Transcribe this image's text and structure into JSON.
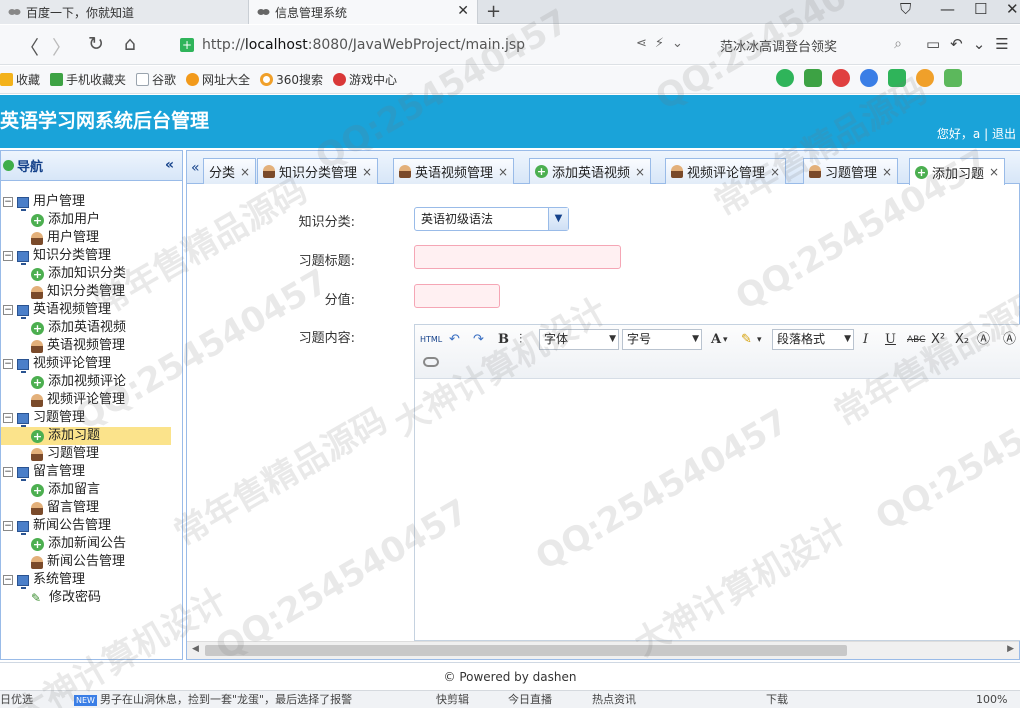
{
  "browser": {
    "tabs": [
      {
        "label": "百度一下，你就知道"
      },
      {
        "label": "信息管理系统"
      }
    ],
    "url_scheme": "http://",
    "url_host": "localhost",
    "url_rest": ":8080/JavaWebProject/main.jsp",
    "search_text": "范冰冰高调登台领奖",
    "bookmarks": [
      {
        "label": "收藏",
        "icon": "star-icon",
        "color": "#f3b21b"
      },
      {
        "label": "手机收藏夹",
        "icon": "phone-icon",
        "color": "#3da244"
      },
      {
        "label": "谷歌",
        "icon": "page-icon",
        "color": "#9aa4ae"
      },
      {
        "label": "网址大全",
        "icon": "globe-icon",
        "color": "#f29a1b"
      },
      {
        "label": "360搜索",
        "icon": "search-circle-icon",
        "color": "#f0a02a"
      },
      {
        "label": "游戏中心",
        "icon": "game-icon",
        "color": "#d93838"
      }
    ]
  },
  "app": {
    "title": "英语学习网系统后台管理",
    "greeting": "您好，a",
    "divider": "|",
    "logout": "退出"
  },
  "sidebar": {
    "title": "导航",
    "collapse": "«",
    "groups": [
      {
        "label": "用户管理",
        "children": [
          {
            "label": "添加用户",
            "icon": "add"
          },
          {
            "label": "用户管理",
            "icon": "user"
          }
        ]
      },
      {
        "label": "知识分类管理",
        "children": [
          {
            "label": "添加知识分类",
            "icon": "add"
          },
          {
            "label": "知识分类管理",
            "icon": "user"
          }
        ]
      },
      {
        "label": "英语视频管理",
        "children": [
          {
            "label": "添加英语视频",
            "icon": "add"
          },
          {
            "label": "英语视频管理",
            "icon": "user"
          }
        ]
      },
      {
        "label": "视频评论管理",
        "children": [
          {
            "label": "添加视频评论",
            "icon": "add"
          },
          {
            "label": "视频评论管理",
            "icon": "user"
          }
        ]
      },
      {
        "label": "习题管理",
        "children": [
          {
            "label": "添加习题",
            "icon": "add",
            "selected": true
          },
          {
            "label": "习题管理",
            "icon": "user"
          }
        ]
      },
      {
        "label": "留言管理",
        "children": [
          {
            "label": "添加留言",
            "icon": "add"
          },
          {
            "label": "留言管理",
            "icon": "user"
          }
        ]
      },
      {
        "label": "新闻公告管理",
        "children": [
          {
            "label": "添加新闻公告",
            "icon": "add"
          },
          {
            "label": "新闻公告管理",
            "icon": "user"
          }
        ]
      },
      {
        "label": "系统管理",
        "children": [
          {
            "label": "修改密码",
            "icon": "pen"
          }
        ]
      }
    ]
  },
  "tabs": [
    {
      "label": "分类",
      "icon": ""
    },
    {
      "label": "知识分类管理",
      "icon": "user"
    },
    {
      "label": "英语视频管理",
      "icon": "user"
    },
    {
      "label": "添加英语视频",
      "icon": "add"
    },
    {
      "label": "视频评论管理",
      "icon": "user"
    },
    {
      "label": "习题管理",
      "icon": "user"
    },
    {
      "label": "添加习题",
      "icon": "add",
      "active": true
    }
  ],
  "tab_close": "×",
  "tab_scroll": "«",
  "form": {
    "category_label": "知识分类:",
    "category_value": "英语初级语法",
    "title_label": "习题标题:",
    "title_value": "",
    "score_label": "分值:",
    "score_value": "",
    "content_label": "习题内容:",
    "toolbar": {
      "html": "HTML",
      "bold": "B",
      "font": "字体",
      "size": "字号",
      "fontcolor": "A",
      "paragraph": "段落格式",
      "italic": "I",
      "underline": "U",
      "strike": "ABC",
      "sup": "X²",
      "sub": "X₂"
    }
  },
  "footer": "© Powered by dashen",
  "statusbar": [
    "日优选",
    "男子在山洞休息，捡到一套\"龙蛋\"，最后选择了报警",
    "快剪辑",
    "今日直播",
    "热点资讯",
    "下载",
    "100%"
  ],
  "watermarks": [
    "QQ:254540457",
    "常年售精品源码",
    "大神计算机设计"
  ]
}
